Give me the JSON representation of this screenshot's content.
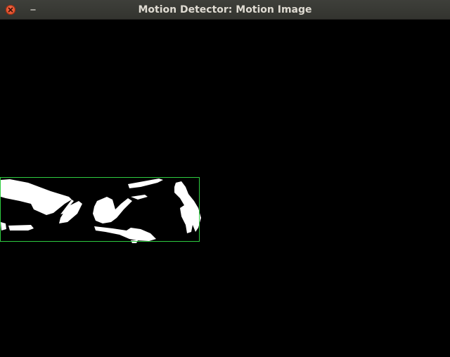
{
  "window": {
    "title": "Motion Detector: Motion Image",
    "close_icon": "close-icon",
    "minimize_icon": "minimize-icon"
  },
  "motion_image": {
    "background": "#000000",
    "blob_color": "#ffffff",
    "bounding_box_color": "#2ecc40"
  }
}
